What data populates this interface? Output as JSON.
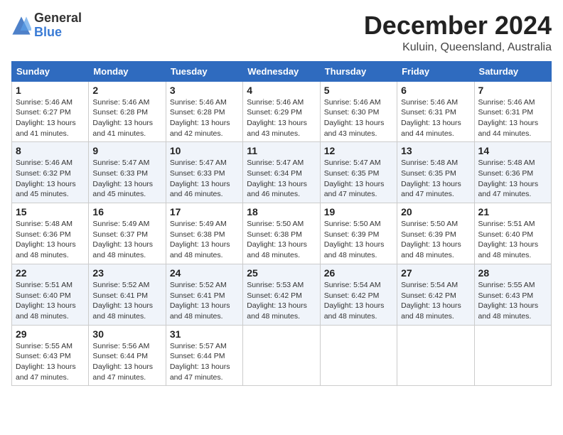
{
  "logo": {
    "general": "General",
    "blue": "Blue"
  },
  "header": {
    "month": "December 2024",
    "location": "Kuluin, Queensland, Australia"
  },
  "weekdays": [
    "Sunday",
    "Monday",
    "Tuesday",
    "Wednesday",
    "Thursday",
    "Friday",
    "Saturday"
  ],
  "weeks": [
    [
      {
        "day": "1",
        "sunrise": "5:46 AM",
        "sunset": "6:27 PM",
        "daylight": "13 hours and 41 minutes."
      },
      {
        "day": "2",
        "sunrise": "5:46 AM",
        "sunset": "6:28 PM",
        "daylight": "13 hours and 41 minutes."
      },
      {
        "day": "3",
        "sunrise": "5:46 AM",
        "sunset": "6:28 PM",
        "daylight": "13 hours and 42 minutes."
      },
      {
        "day": "4",
        "sunrise": "5:46 AM",
        "sunset": "6:29 PM",
        "daylight": "13 hours and 43 minutes."
      },
      {
        "day": "5",
        "sunrise": "5:46 AM",
        "sunset": "6:30 PM",
        "daylight": "13 hours and 43 minutes."
      },
      {
        "day": "6",
        "sunrise": "5:46 AM",
        "sunset": "6:31 PM",
        "daylight": "13 hours and 44 minutes."
      },
      {
        "day": "7",
        "sunrise": "5:46 AM",
        "sunset": "6:31 PM",
        "daylight": "13 hours and 44 minutes."
      }
    ],
    [
      {
        "day": "8",
        "sunrise": "5:46 AM",
        "sunset": "6:32 PM",
        "daylight": "13 hours and 45 minutes."
      },
      {
        "day": "9",
        "sunrise": "5:47 AM",
        "sunset": "6:33 PM",
        "daylight": "13 hours and 45 minutes."
      },
      {
        "day": "10",
        "sunrise": "5:47 AM",
        "sunset": "6:33 PM",
        "daylight": "13 hours and 46 minutes."
      },
      {
        "day": "11",
        "sunrise": "5:47 AM",
        "sunset": "6:34 PM",
        "daylight": "13 hours and 46 minutes."
      },
      {
        "day": "12",
        "sunrise": "5:47 AM",
        "sunset": "6:35 PM",
        "daylight": "13 hours and 47 minutes."
      },
      {
        "day": "13",
        "sunrise": "5:48 AM",
        "sunset": "6:35 PM",
        "daylight": "13 hours and 47 minutes."
      },
      {
        "day": "14",
        "sunrise": "5:48 AM",
        "sunset": "6:36 PM",
        "daylight": "13 hours and 47 minutes."
      }
    ],
    [
      {
        "day": "15",
        "sunrise": "5:48 AM",
        "sunset": "6:36 PM",
        "daylight": "13 hours and 48 minutes."
      },
      {
        "day": "16",
        "sunrise": "5:49 AM",
        "sunset": "6:37 PM",
        "daylight": "13 hours and 48 minutes."
      },
      {
        "day": "17",
        "sunrise": "5:49 AM",
        "sunset": "6:38 PM",
        "daylight": "13 hours and 48 minutes."
      },
      {
        "day": "18",
        "sunrise": "5:50 AM",
        "sunset": "6:38 PM",
        "daylight": "13 hours and 48 minutes."
      },
      {
        "day": "19",
        "sunrise": "5:50 AM",
        "sunset": "6:39 PM",
        "daylight": "13 hours and 48 minutes."
      },
      {
        "day": "20",
        "sunrise": "5:50 AM",
        "sunset": "6:39 PM",
        "daylight": "13 hours and 48 minutes."
      },
      {
        "day": "21",
        "sunrise": "5:51 AM",
        "sunset": "6:40 PM",
        "daylight": "13 hours and 48 minutes."
      }
    ],
    [
      {
        "day": "22",
        "sunrise": "5:51 AM",
        "sunset": "6:40 PM",
        "daylight": "13 hours and 48 minutes."
      },
      {
        "day": "23",
        "sunrise": "5:52 AM",
        "sunset": "6:41 PM",
        "daylight": "13 hours and 48 minutes."
      },
      {
        "day": "24",
        "sunrise": "5:52 AM",
        "sunset": "6:41 PM",
        "daylight": "13 hours and 48 minutes."
      },
      {
        "day": "25",
        "sunrise": "5:53 AM",
        "sunset": "6:42 PM",
        "daylight": "13 hours and 48 minutes."
      },
      {
        "day": "26",
        "sunrise": "5:54 AM",
        "sunset": "6:42 PM",
        "daylight": "13 hours and 48 minutes."
      },
      {
        "day": "27",
        "sunrise": "5:54 AM",
        "sunset": "6:42 PM",
        "daylight": "13 hours and 48 minutes."
      },
      {
        "day": "28",
        "sunrise": "5:55 AM",
        "sunset": "6:43 PM",
        "daylight": "13 hours and 48 minutes."
      }
    ],
    [
      {
        "day": "29",
        "sunrise": "5:55 AM",
        "sunset": "6:43 PM",
        "daylight": "13 hours and 47 minutes."
      },
      {
        "day": "30",
        "sunrise": "5:56 AM",
        "sunset": "6:44 PM",
        "daylight": "13 hours and 47 minutes."
      },
      {
        "day": "31",
        "sunrise": "5:57 AM",
        "sunset": "6:44 PM",
        "daylight": "13 hours and 47 minutes."
      },
      null,
      null,
      null,
      null
    ]
  ],
  "labels": {
    "sunrise": "Sunrise:",
    "sunset": "Sunset:",
    "daylight": "Daylight:"
  }
}
